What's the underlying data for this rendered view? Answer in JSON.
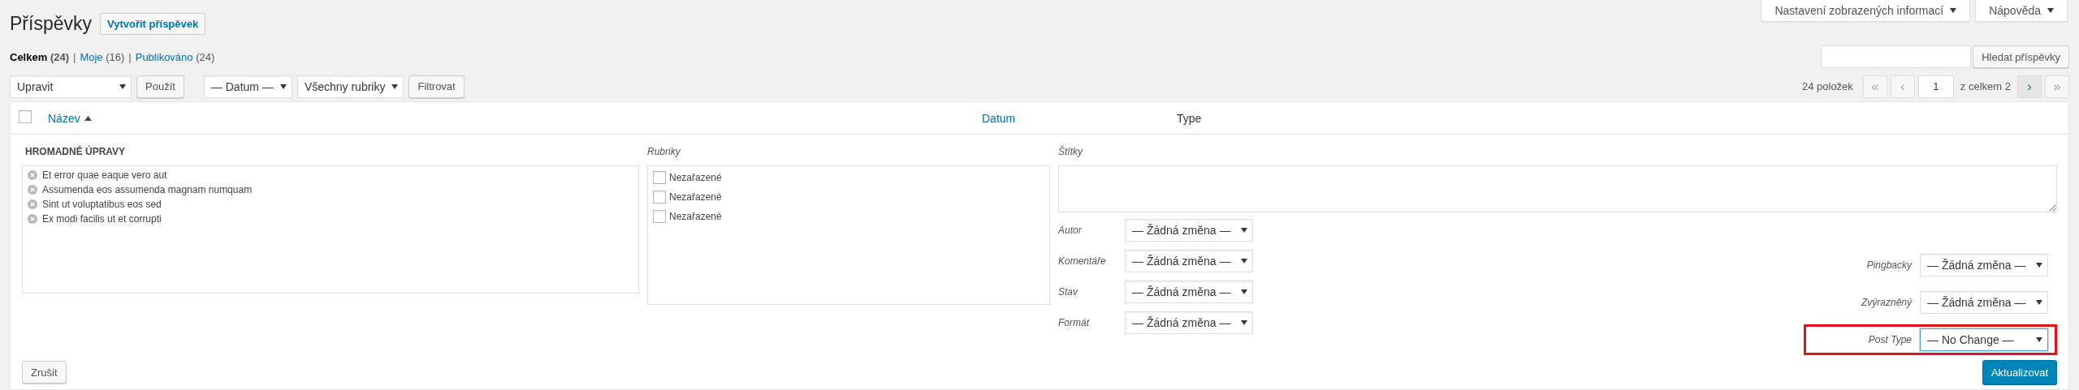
{
  "page_title": "Příspěvky",
  "add_new": "Vytvořit příspěvek",
  "screen_tabs": [
    {
      "label": "Nastavení zobrazených informací"
    },
    {
      "label": "Nápověda"
    }
  ],
  "views": [
    {
      "label": "Celkem",
      "count": "(24)",
      "selected": true,
      "separator": "|"
    },
    {
      "label": "Moje",
      "count": "(16)",
      "selected": false,
      "separator": "|"
    },
    {
      "label": "Publikováno",
      "count": "(24)",
      "selected": false
    }
  ],
  "search": {
    "button": "Hledat příspěvky"
  },
  "bulk_action": {
    "value": "Upravit",
    "button": "Použít"
  },
  "filters": [
    {
      "value": "— Datum —"
    },
    {
      "value": "Všechny rubriky"
    }
  ],
  "filter_button": "Filtrovat",
  "pagination": {
    "count": "24 položek",
    "page": "1",
    "total": "z celkem 2",
    "buttons_before": [
      {
        "label": "«",
        "disabled": true
      },
      {
        "label": "‹",
        "disabled": true
      }
    ],
    "buttons_after": [
      {
        "label": "›",
        "disabled": false
      },
      {
        "label": "»",
        "disabled": true
      }
    ]
  },
  "table": {
    "select_all": {
      "checked": false
    },
    "columns": [
      {
        "label": "Název",
        "kind": "link",
        "sorted": true
      },
      {
        "label": "Datum",
        "kind": "link",
        "sorted": false
      },
      {
        "label": "Type",
        "kind": "plain",
        "sorted": false
      }
    ]
  },
  "bulk_edit": {
    "title": "HROMADNÉ ÚPRAVY",
    "posts": [
      "Et error quae eaque vero aut",
      "Assumenda eos assumenda magnam numquam",
      "Sint ut voluptatibus eos sed",
      "Ex modi facilis ut et corrupti"
    ],
    "categories_label": "Rubriky",
    "categories": [
      {
        "label": "Nezařazené",
        "checked": false
      },
      {
        "label": "Nezařazené",
        "checked": false
      },
      {
        "label": "Nezařazené",
        "checked": false
      }
    ],
    "tags_label": "Štítky",
    "left_fields": [
      {
        "label": "Autor",
        "value": "— Žádná změna —"
      },
      {
        "label": "Komentáře",
        "value": "— Žádná změna —"
      },
      {
        "label": "Stav",
        "value": "— Žádná změna —"
      },
      {
        "label": "Formát",
        "value": "— Žádná změna —"
      }
    ],
    "right_fields": [
      {
        "label": "Pingbacky",
        "value": "— Žádná změna —",
        "highlighted": false,
        "focused": false
      },
      {
        "label": "Zvýrazněný",
        "value": "— Žádná změna —",
        "highlighted": false,
        "focused": false
      },
      {
        "label": "Post Type",
        "value": "— No Change —",
        "highlighted": true,
        "focused": true
      }
    ],
    "cancel": "Zrušit",
    "update": "Aktualizovat"
  }
}
